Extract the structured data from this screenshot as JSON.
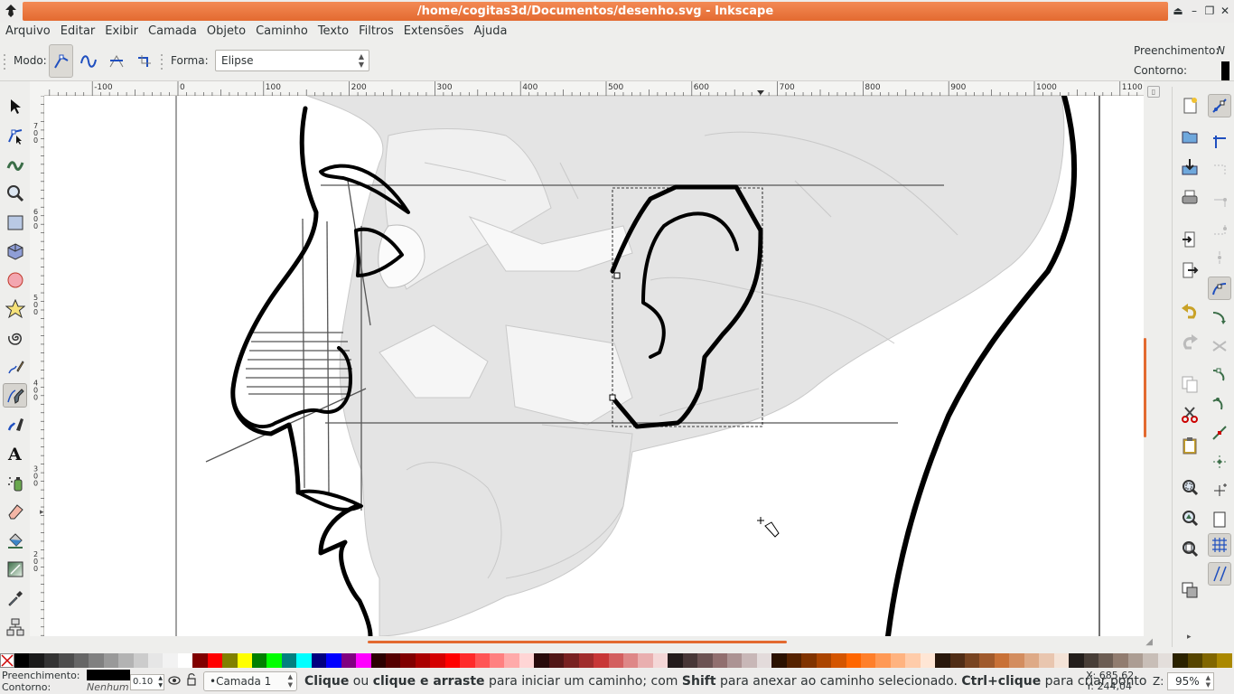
{
  "window": {
    "title": "/home/cogitas3d/Documentos/desenho.svg - Inkscape"
  },
  "menu": [
    "Arquivo",
    "Editar",
    "Exibir",
    "Camada",
    "Objeto",
    "Caminho",
    "Texto",
    "Filtros",
    "Extensões",
    "Ajuda"
  ],
  "toolcontrols": {
    "mode_label": "Modo:",
    "shape_label": "Forma:",
    "shape_value": "Elipse",
    "fill_label": "Preenchimento:",
    "fill_value": "N",
    "stroke_label": "Contorno:"
  },
  "ruler": {
    "h_ticks": [
      "-100",
      "0",
      "100",
      "200",
      "300",
      "400",
      "500",
      "600",
      "700",
      "800",
      "900",
      "1000",
      "1100"
    ],
    "v_ticks": [
      "700",
      "600",
      "500",
      "400",
      "300",
      "200"
    ]
  },
  "palette": {
    "colors": [
      "#000000",
      "#1a1a1a",
      "#333333",
      "#4d4d4d",
      "#666666",
      "#808080",
      "#999999",
      "#b3b3b3",
      "#cccccc",
      "#e6e6e6",
      "#f2f2f2",
      "#ffffff",
      "#800000",
      "#ff0000",
      "#808000",
      "#ffff00",
      "#008000",
      "#00ff00",
      "#008080",
      "#00ffff",
      "#000080",
      "#0000ff",
      "#800080",
      "#ff00ff",
      "#2b0000",
      "#550000",
      "#800000",
      "#aa0000",
      "#d40000",
      "#ff0000",
      "#ff2a2a",
      "#ff5555",
      "#ff8080",
      "#ffaaaa",
      "#ffd5d5",
      "#280b0b",
      "#501616",
      "#782121",
      "#a02c2c",
      "#c83737",
      "#d35f5f",
      "#de8787",
      "#e9afaf",
      "#f4d7d7",
      "#241c1c",
      "#483737",
      "#6c5353",
      "#916f6f",
      "#ac9393",
      "#c8b7b7",
      "#e3dbdb",
      "#2b1100",
      "#552200",
      "#803300",
      "#aa4400",
      "#d45500",
      "#ff6600",
      "#ff7f2a",
      "#ff9955",
      "#ffb380",
      "#ffccaa",
      "#ffe6d5",
      "#28170b",
      "#502d16",
      "#784421",
      "#a05a2c",
      "#c87137",
      "#d38d5f",
      "#deaa87",
      "#e9c6af",
      "#f4e3d7",
      "#241f1c",
      "#483e37",
      "#6c5d53",
      "#917c6f",
      "#ac9d93",
      "#c8beb7",
      "#e3dedb",
      "#2b2200",
      "#554400",
      "#806600",
      "#aa8800"
    ]
  },
  "status": {
    "fill_label": "Preenchimento:",
    "stroke_label": "Contorno:",
    "stroke_value": "Nenhum",
    "stroke_width": "0.10",
    "layer": "•Camada 1",
    "message_parts": [
      {
        "b": true,
        "t": "Clique"
      },
      {
        "b": false,
        "t": " ou "
      },
      {
        "b": true,
        "t": "clique e arraste"
      },
      {
        "b": false,
        "t": " para iniciar um caminho; com "
      },
      {
        "b": true,
        "t": "Shift"
      },
      {
        "b": false,
        "t": " para anexar ao caminho selecionado. "
      },
      {
        "b": true,
        "t": "Ctrl+clique"
      },
      {
        "b": false,
        "t": " para criar ponto"
      }
    ],
    "coord_x_label": "X:",
    "coord_x": "685,62",
    "coord_y_label": "Y:",
    "coord_y": "244,04",
    "zoom_label": "Z:",
    "zoom_value": "95%"
  },
  "accent": "#e36a30"
}
